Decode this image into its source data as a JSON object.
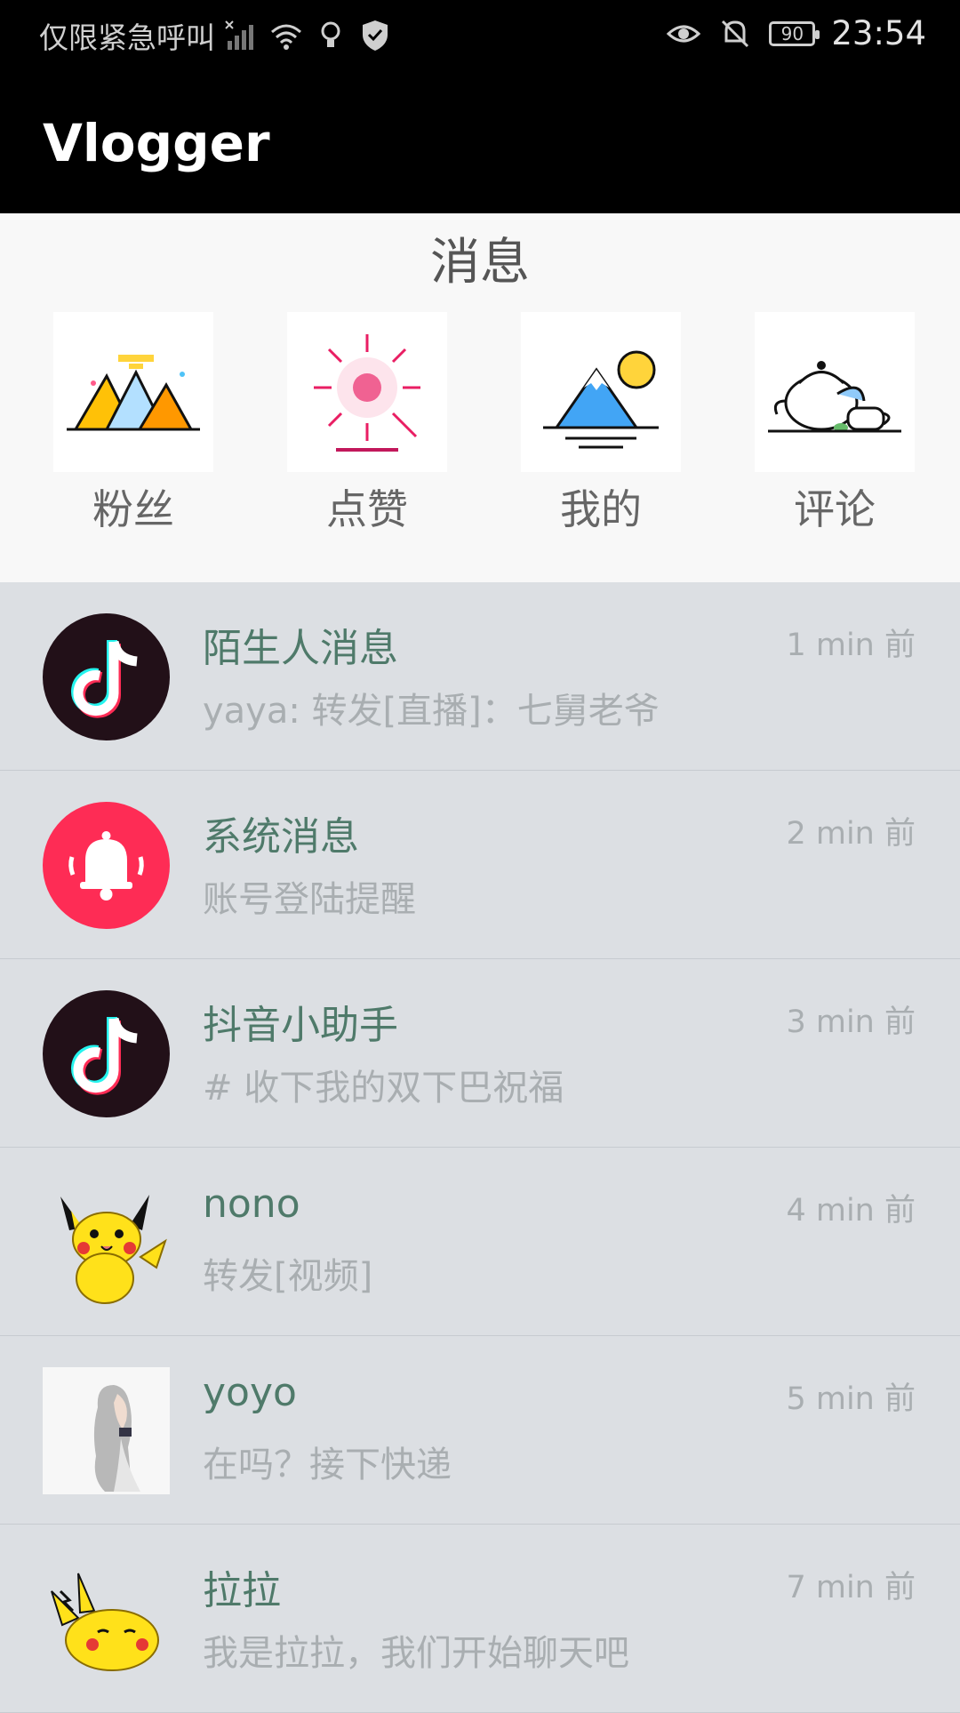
{
  "status_bar": {
    "carrier": "仅限紧急呼叫",
    "battery": "90",
    "time": "23:54"
  },
  "app": {
    "title": "Vlogger"
  },
  "panel": {
    "title": "消息",
    "categories": [
      {
        "label": "粉丝"
      },
      {
        "label": "点赞"
      },
      {
        "label": "我的"
      },
      {
        "label": "评论"
      }
    ]
  },
  "messages": [
    {
      "name": "陌生人消息",
      "preview": "yaya: 转发[直播]：七舅老爷",
      "time": "1 min 前"
    },
    {
      "name": "系统消息",
      "preview": "账号登陆提醒",
      "time": "2 min 前"
    },
    {
      "name": "抖音小助手",
      "preview": "# 收下我的双下巴祝福",
      "time": "3 min 前"
    },
    {
      "name": "nono",
      "preview": "转发[视频]",
      "time": "4 min 前"
    },
    {
      "name": "yoyo",
      "preview": "在吗？接下快递",
      "time": "5 min 前"
    },
    {
      "name": "拉拉",
      "preview": "我是拉拉，我们开始聊天吧",
      "time": "7 min 前"
    }
  ],
  "colors": {
    "status_bar_bg": "#000000",
    "list_bg": "#dcdfe3",
    "name_color": "#4f7a6a",
    "secondary_text": "#a9aeb1",
    "bell_bg": "#fe2c55"
  }
}
